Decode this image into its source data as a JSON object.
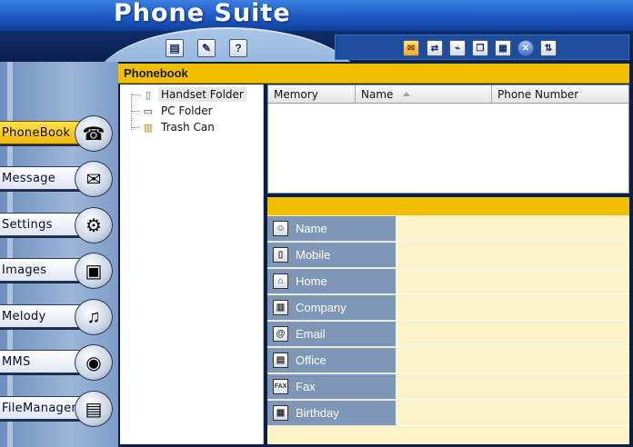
{
  "app": {
    "title": "Phone Suite"
  },
  "toolbar_left": [
    {
      "name": "new-contact-icon",
      "glyph": "▤"
    },
    {
      "name": "edit-contact-icon",
      "glyph": "✎"
    },
    {
      "name": "help-icon",
      "glyph": "?"
    }
  ],
  "toolbar_right": [
    {
      "name": "send-message-icon",
      "glyph": "✉"
    },
    {
      "name": "receive-icon",
      "glyph": "⇄"
    },
    {
      "name": "connect-icon",
      "glyph": "⌁"
    },
    {
      "name": "copy-icon",
      "glyph": "❐"
    },
    {
      "name": "paste-icon",
      "glyph": "▦"
    },
    {
      "name": "close-connection-icon",
      "glyph": "✕"
    },
    {
      "name": "sort-icon",
      "glyph": "⇅"
    }
  ],
  "sidebar": {
    "items": [
      {
        "label": "PhoneBook",
        "icon": "phone-icon",
        "glyph": "☎",
        "active": true
      },
      {
        "label": "Message",
        "icon": "envelope-icon",
        "glyph": "✉",
        "active": false
      },
      {
        "label": "Settings",
        "icon": "gear-icon",
        "glyph": "⚙",
        "active": false
      },
      {
        "label": "Images",
        "icon": "picture-icon",
        "glyph": "▣",
        "active": false
      },
      {
        "label": "Melody",
        "icon": "music-icon",
        "glyph": "♫",
        "active": false
      },
      {
        "label": "MMS",
        "icon": "balloon-icon",
        "glyph": "◉",
        "active": false
      },
      {
        "label": "FileManager",
        "icon": "file-box-icon",
        "glyph": "▤",
        "active": false
      }
    ]
  },
  "main": {
    "header": "Phonebook",
    "tree": [
      {
        "label": "Handset Folder",
        "icon": "handset-icon",
        "glyph": "▯",
        "selected": true
      },
      {
        "label": "PC Folder",
        "icon": "pc-icon",
        "glyph": "▭",
        "selected": false
      },
      {
        "label": "Trash Can",
        "icon": "trash-icon",
        "glyph": "▥",
        "selected": false
      }
    ],
    "table": {
      "columns": [
        "Memory",
        "Name",
        "Phone Number"
      ]
    },
    "form": {
      "fields": [
        {
          "label": "Name",
          "icon": "person-icon",
          "glyph": "☺",
          "value": ""
        },
        {
          "label": "Mobile",
          "icon": "mobile-icon",
          "glyph": "▯",
          "value": ""
        },
        {
          "label": "Home",
          "icon": "house-icon",
          "glyph": "⌂",
          "value": ""
        },
        {
          "label": "Company",
          "icon": "building-icon",
          "glyph": "▥",
          "value": ""
        },
        {
          "label": "Email",
          "icon": "at-icon",
          "glyph": "@",
          "value": ""
        },
        {
          "label": "Office",
          "icon": "office-icon",
          "glyph": "▤",
          "value": ""
        },
        {
          "label": "Fax",
          "icon": "fax-icon",
          "glyph": "FAX",
          "value": ""
        },
        {
          "label": "Birthday",
          "icon": "calendar-icon",
          "glyph": "▦",
          "value": ""
        }
      ]
    }
  }
}
